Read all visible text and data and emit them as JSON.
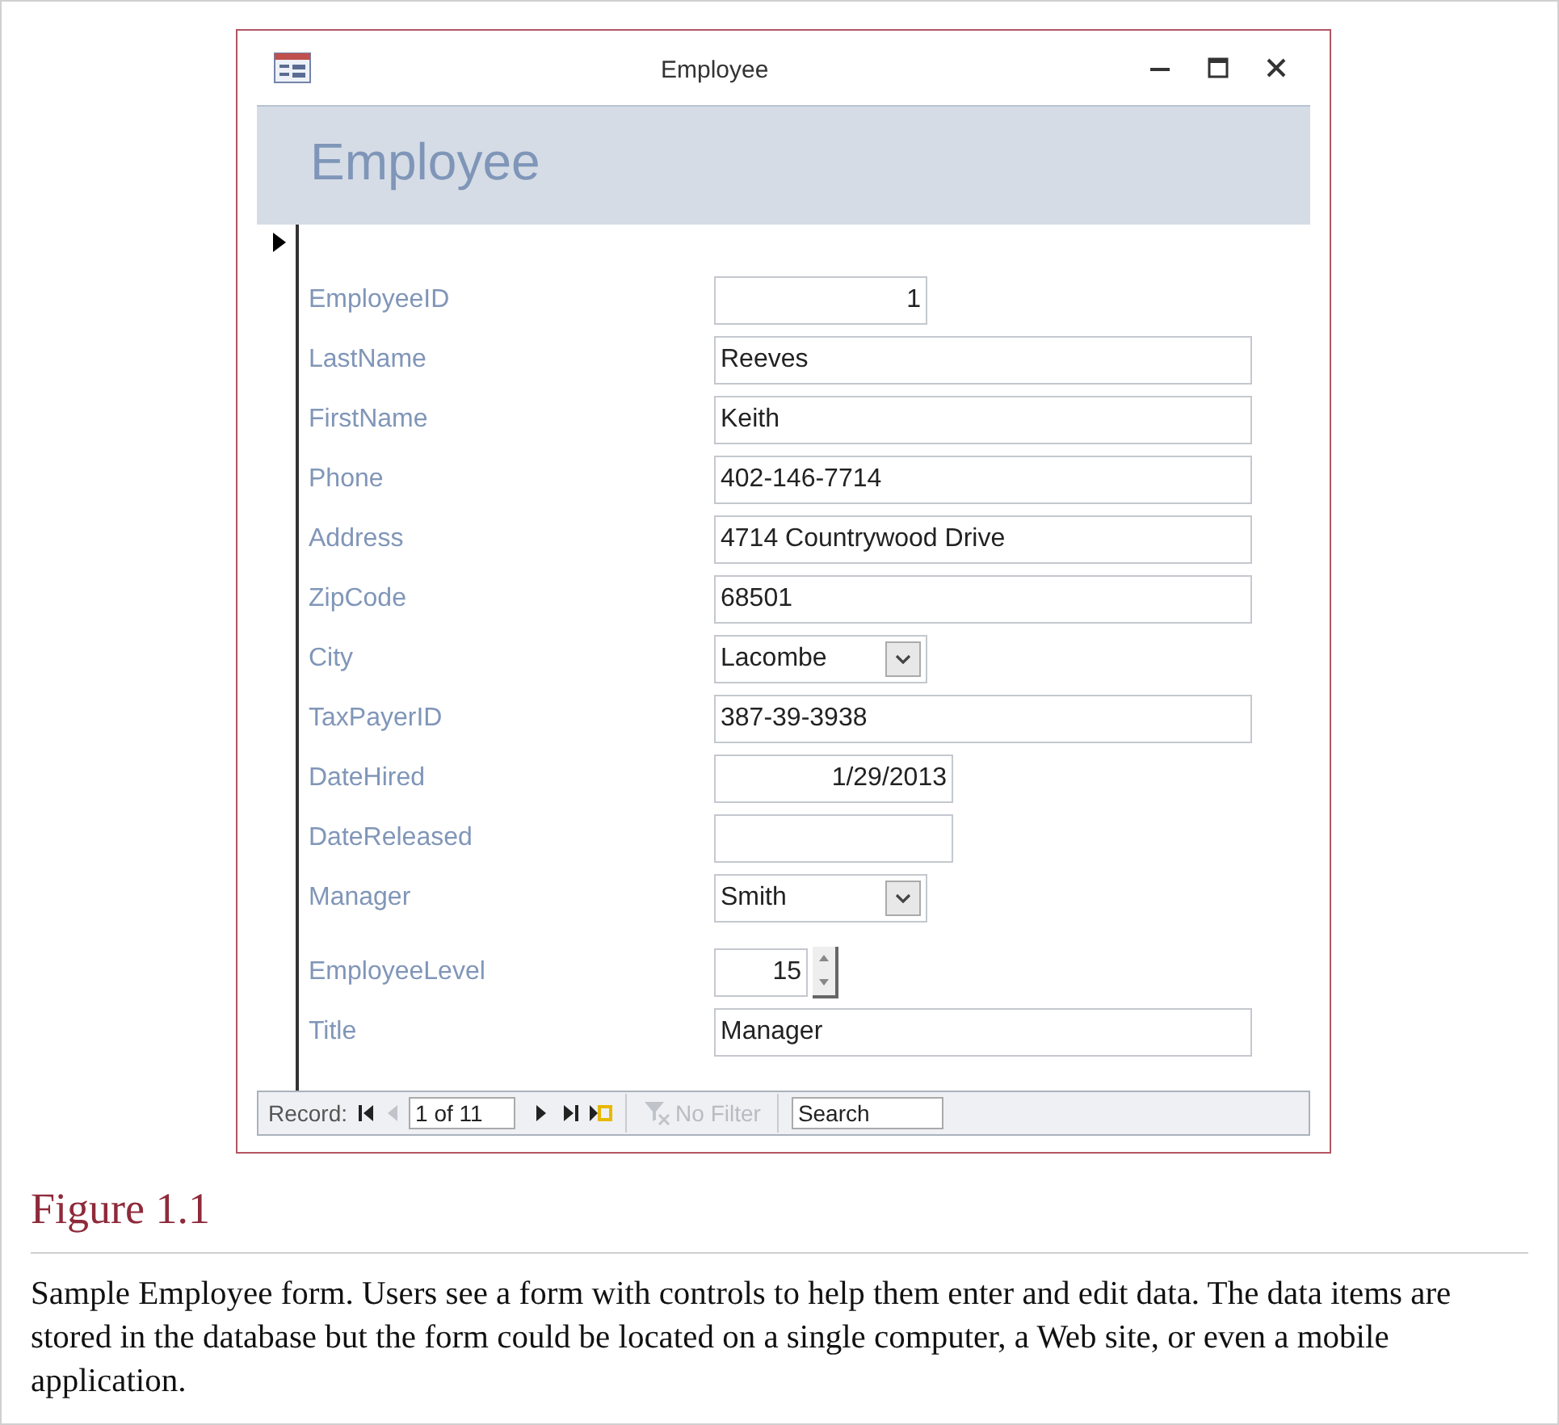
{
  "window": {
    "title": "Employee"
  },
  "form_header": {
    "title": "Employee"
  },
  "fields": [
    {
      "label": "EmployeeID",
      "kind": "number",
      "value": "1"
    },
    {
      "label": "LastName",
      "kind": "text",
      "value": "Reeves"
    },
    {
      "label": "FirstName",
      "kind": "text",
      "value": "Keith"
    },
    {
      "label": "Phone",
      "kind": "text",
      "value": "402-146-7714"
    },
    {
      "label": "Address",
      "kind": "text",
      "value": "4714 Countrywood Drive"
    },
    {
      "label": "ZipCode",
      "kind": "text",
      "value": "68501"
    },
    {
      "label": "City",
      "kind": "combo",
      "value": "Lacombe"
    },
    {
      "label": "TaxPayerID",
      "kind": "text",
      "value": "387-39-3938"
    },
    {
      "label": "DateHired",
      "kind": "date",
      "value": "1/29/2013"
    },
    {
      "label": "DateReleased",
      "kind": "date"
    },
    {
      "label": "Manager",
      "kind": "combo",
      "value": "Smith"
    },
    {
      "label": "EmployeeLevel",
      "kind": "spinner",
      "value": "15"
    },
    {
      "label": "Title",
      "kind": "text",
      "value": "Manager"
    }
  ],
  "navigation": {
    "label": "Record:",
    "position": "1 of 11",
    "filter": {
      "label": "No Filter",
      "disabled": true
    },
    "search": {
      "placeholder": "Search"
    },
    "buttons": [
      {
        "kind": "first",
        "disabled": false
      },
      {
        "kind": "previous",
        "disabled": true
      },
      {
        "kind": "next",
        "disabled": false
      },
      {
        "kind": "last",
        "disabled": false
      },
      {
        "kind": "new",
        "disabled": false
      }
    ]
  },
  "caption": {
    "title": "Figure 1.1",
    "text": "Sample Employee form. Users see a form with controls to help them enter and edit data. The data items are stored in the database but the form could be located on a single computer, a Web site, or even a mobile application."
  }
}
